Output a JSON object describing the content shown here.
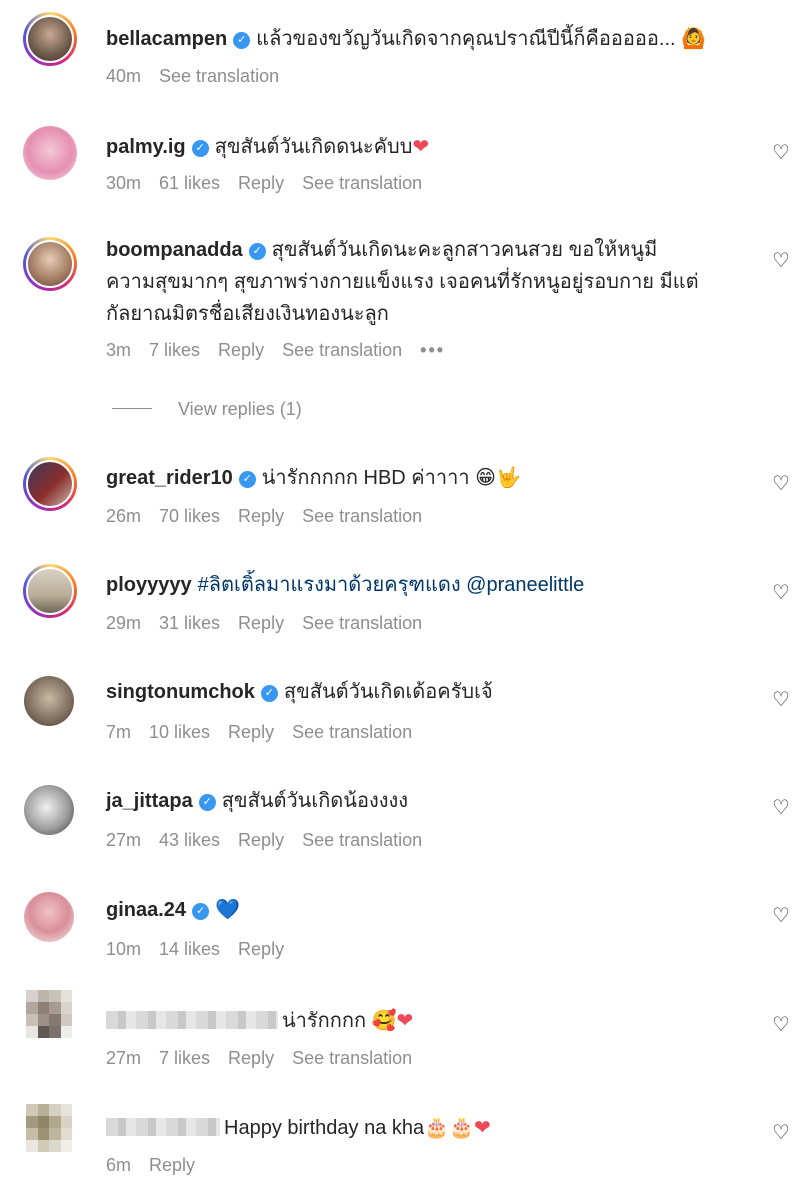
{
  "comments": [
    {
      "user": "bellacampen",
      "verified": true,
      "text": "แล้วของขวัญวันเกิดจากคุณปราณีปีนี้ก็คือออออ...",
      "emoji": "🙆",
      "time": "40m",
      "likes": "",
      "reply": "",
      "translate": "See translation",
      "heart": false
    },
    {
      "user": "palmy.ig",
      "verified": true,
      "text": "สุขสันต์วันเกิดดนะคับบ",
      "emoji": "❤",
      "time": "30m",
      "likes": "61 likes",
      "reply": "Reply",
      "translate": "See translation",
      "heart": true
    },
    {
      "user": "boompanadda",
      "verified": true,
      "text": "สุขสันต์วันเกิดนะคะลูกสาวคนสวย ขอให้หนูมี",
      "text2": "ความสุขมากๆ สุขภาพร่างกายแข็งแรง เจอคนที่รักหนูอยู่รอบกาย มีแต่",
      "text3": "กัลยาณมิตรชื่อเสียงเงินทองนะลูก",
      "time": "3m",
      "likes": "7 likes",
      "reply": "Reply",
      "translate": "See translation",
      "more": "•••",
      "heart": true
    },
    {
      "user": "great_rider10",
      "verified": true,
      "text": "น่ารักกกกก HBD ค่าาาา",
      "emoji": "😁🤟",
      "time": "26m",
      "likes": "70 likes",
      "reply": "Reply",
      "translate": "See translation",
      "heart": true
    },
    {
      "user": "ployyyyy",
      "verified": false,
      "text": "#ลิตเติ้ลมาแรงมาด้วยครุฑแดง @praneelittle",
      "time": "29m",
      "likes": "31 likes",
      "reply": "Reply",
      "translate": "See translation",
      "heart": true
    },
    {
      "user": "singtonumchok",
      "verified": true,
      "text": "สุขสันต์วันเกิดเด้อครับเจ้",
      "time": "7m",
      "likes": "10 likes",
      "reply": "Reply",
      "translate": "See translation",
      "heart": true
    },
    {
      "user": "ja_jittapa",
      "verified": true,
      "text": "สุขสันต์วันเกิดน้องงงง",
      "time": "27m",
      "likes": "43 likes",
      "reply": "Reply",
      "translate": "See translation",
      "heart": true
    },
    {
      "user": "ginaa.24",
      "verified": true,
      "text": "",
      "emoji": "💙",
      "time": "10m",
      "likes": "14 likes",
      "reply": "Reply",
      "translate": "",
      "heart": true
    },
    {
      "user": "",
      "verified": false,
      "text": "น่ารักกกก",
      "emoji": "🥰❤",
      "time": "27m",
      "likes": "7 likes",
      "reply": "Reply",
      "translate": "See translation",
      "heart": true
    },
    {
      "user": "",
      "verified": false,
      "text": "Happy birthday na kha",
      "emoji": "🎂🎂❤",
      "time": "6m",
      "likes": "",
      "reply": "Reply",
      "translate": "",
      "heart": true
    }
  ],
  "view_replies": "View replies (1)",
  "icons": {
    "verified": "verified-badge-icon",
    "heart": "heart-outline-icon"
  },
  "colors": {
    "verified": "#3897f0",
    "meta": "#8e8e8e",
    "mention": "#00376b",
    "heart_red": "#ed4956"
  }
}
